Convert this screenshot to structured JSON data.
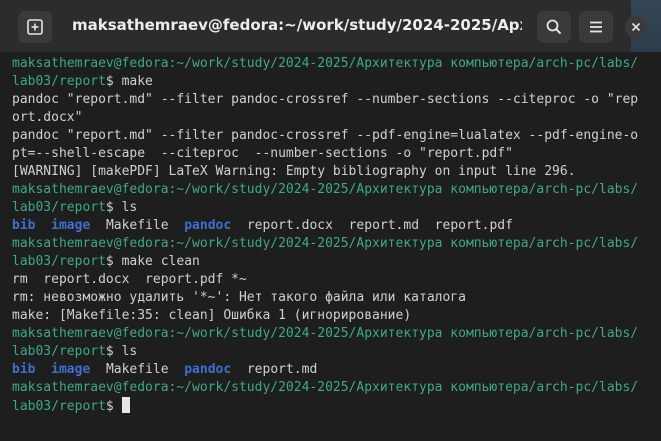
{
  "window": {
    "title": "maksathemraev@fedora:~/work/study/2024-2025/Архитектур...",
    "new_tab_icon": "new-tab-icon",
    "search_icon": "search-icon",
    "menu_icon": "hamburger-menu-icon",
    "close_icon": "close-icon"
  },
  "colors": {
    "prompt": "#3da98a",
    "directory": "#3e6fd1",
    "text": "#d0d0d0",
    "background": "#1e1e1e"
  },
  "terminal": {
    "lines": [
      {
        "kind": "prompt",
        "prompt": "maksathemraev@fedora:~/work/study/2024-2025/Архитектура компьютера/arch-pc/labs/"
      },
      {
        "kind": "prompt_cont",
        "prompt": "lab03/report",
        "cmd": "$ make"
      },
      {
        "kind": "out",
        "text": "pandoc \"report.md\" --filter pandoc-crossref --number-sections --citeproc -o \"rep"
      },
      {
        "kind": "out",
        "text": "ort.docx\""
      },
      {
        "kind": "out",
        "text": "pandoc \"report.md\" --filter pandoc-crossref --pdf-engine=lualatex --pdf-engine-o"
      },
      {
        "kind": "out",
        "text": "pt=--shell-escape  --citeproc  --number-sections -o \"report.pdf\""
      },
      {
        "kind": "out",
        "text": "[WARNING] [makePDF] LaTeX Warning: Empty bibliography on input line 296."
      },
      {
        "kind": "prompt",
        "prompt": "maksathemraev@fedora:~/work/study/2024-2025/Архитектура компьютера/arch-pc/labs/"
      },
      {
        "kind": "prompt_cont",
        "prompt": "lab03/report",
        "cmd": "$ ls"
      },
      {
        "kind": "ls1"
      },
      {
        "kind": "prompt",
        "prompt": "maksathemraev@fedora:~/work/study/2024-2025/Архитектура компьютера/arch-pc/labs/"
      },
      {
        "kind": "prompt_cont",
        "prompt": "lab03/report",
        "cmd": "$ make clean"
      },
      {
        "kind": "out",
        "text": "rm  report.docx  report.pdf *~"
      },
      {
        "kind": "out",
        "text": "rm: невозможно удалить '*~': Нет такого файла или каталога"
      },
      {
        "kind": "out",
        "text": "make: [Makefile:35: clean] Ошибка 1 (игнорирование)"
      },
      {
        "kind": "prompt",
        "prompt": "maksathemraev@fedora:~/work/study/2024-2025/Архитектура компьютера/arch-pc/labs/"
      },
      {
        "kind": "prompt_cont",
        "prompt": "lab03/report",
        "cmd": "$ ls"
      },
      {
        "kind": "ls2"
      },
      {
        "kind": "prompt",
        "prompt": "maksathemraev@fedora:~/work/study/2024-2025/Архитектура компьютера/arch-pc/labs/"
      },
      {
        "kind": "prompt_cont",
        "prompt": "lab03/report",
        "cmd": "$ "
      }
    ],
    "ls1": {
      "dirs": [
        "bib",
        "image"
      ],
      "file1": "Makefile",
      "dir2": "pandoc",
      "files": "report.docx  report.md  report.pdf"
    },
    "ls2": {
      "dirs": [
        "bib",
        "image"
      ],
      "file1": "Makefile",
      "dir2": "pandoc",
      "files": "report.md"
    }
  }
}
